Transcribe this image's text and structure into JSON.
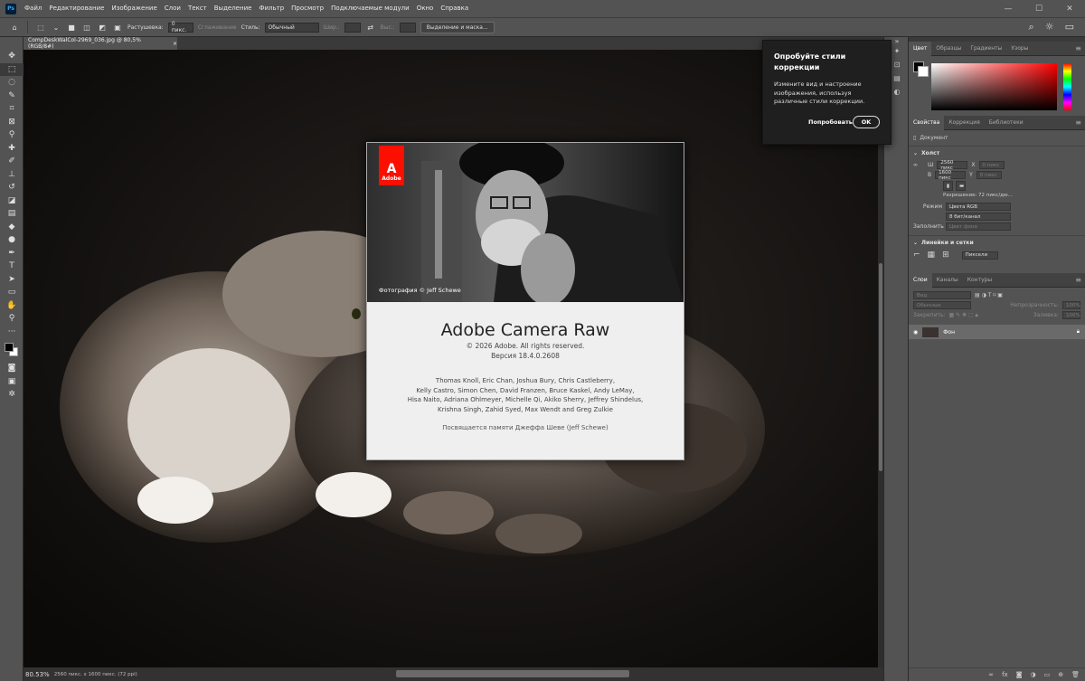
{
  "app": {
    "logo": "Ps"
  },
  "menu": [
    "Файл",
    "Редактирование",
    "Изображение",
    "Слои",
    "Текст",
    "Выделение",
    "Фильтр",
    "Просмотр",
    "Подключаемые модули",
    "Окно",
    "Справка"
  ],
  "window_controls": {
    "minimize": "—",
    "maximize": "☐",
    "close": "✕"
  },
  "options_bar": {
    "feather_label": "Растушевка:",
    "feather_value": "0 пикс.",
    "antialias_label": "Сглаживание",
    "style_label": "Стиль:",
    "style_value": "Обычный",
    "width_label": "Шир.:",
    "height_label": "Выс.:",
    "select_mask_button": "Выделение и маска..."
  },
  "document_tab": {
    "title": "CompDeskWalCol-2969_036.jpg @ 80,5% (RGB/8#)",
    "close": "×"
  },
  "status": {
    "zoom": "80.53%",
    "info": "2560 пикс. x 1600 пикс. (72 ppi)"
  },
  "tip": {
    "title": "Опробуйте стили коррекции",
    "body": "Измените вид и настроение изображения, используя различные стили коррекции.",
    "try_button": "Попробовать",
    "ok_button": "OK"
  },
  "splash": {
    "adobe": "Adobe",
    "photo_credit": "Фотография © Jeff Schewe",
    "title": "Adobe Camera Raw",
    "copyright": "© 2026 Adobe. All rights reserved.",
    "version": "Версия 18.4.0.2608",
    "credits": [
      "Thomas Knoll, Eric Chan, Joshua Bury, Chris Castleberry,",
      "Kelly Castro, Simon Chen, David Franzen, Bruce Kaskel, Andy LeMay,",
      "Hisa Naito, Adriana Ohlmeyer, Michelle Qi, Akiko Sherry, Jeffrey Shindelus,",
      "Krishna Singh, Zahid Syed, Max Wendt and Greg Zulkie"
    ],
    "dedication": "Посвящается памяти Джеффа Шеве (Jeff Schewe)"
  },
  "color_panel": {
    "tabs": [
      "Цвет",
      "Образцы",
      "Градиенты",
      "Узоры"
    ]
  },
  "props_panel": {
    "tabs": [
      "Свойства",
      "Коррекция",
      "Библиотеки"
    ],
    "document_label": "Документ",
    "canvas_section": "Холст",
    "w_label": "Ш",
    "w_value": "2560 пикс",
    "h_label": "В",
    "h_value": "1600 пикс",
    "x_label": "X",
    "x_value": "0 пикс",
    "y_label": "Y",
    "y_value": "0 пикс",
    "resolution": "Разрешение: 72 пикс/дю...",
    "mode_label": "Режим",
    "mode_value": "Цвета RGB",
    "depth_value": "8 бит/канал",
    "fill_label": "Заполнить",
    "fill_value": "Цвет фона",
    "rulers_section": "Линейки и сетки",
    "units_value": "Пиксели"
  },
  "layers_panel": {
    "tabs": [
      "Слои",
      "Каналы",
      "Контуры"
    ],
    "search_placeholder": "Вид",
    "blend_mode": "Обычные",
    "opacity_label": "Непрозрачность:",
    "opacity_value": "100%",
    "lock_label": "Закрепить:",
    "fill_label": "Заливка:",
    "fill_value": "100%",
    "layer_name": "Фон"
  },
  "colors": {
    "accent": "#fa0f00",
    "ps_blue": "#31a8ff"
  }
}
